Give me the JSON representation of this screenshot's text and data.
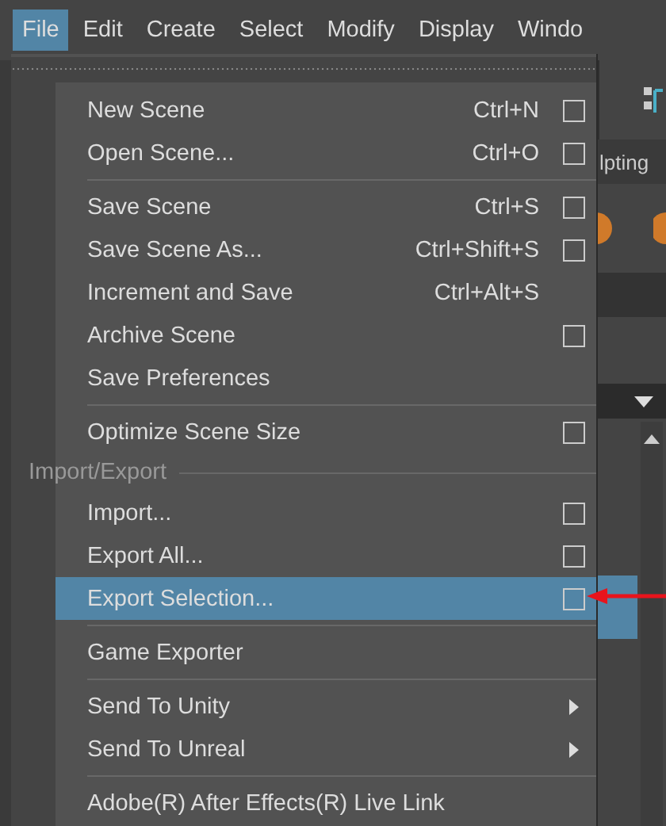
{
  "menubar": [
    {
      "label": "File",
      "selected": true
    },
    {
      "label": "Edit",
      "selected": false
    },
    {
      "label": "Create",
      "selected": false
    },
    {
      "label": "Select",
      "selected": false
    },
    {
      "label": "Modify",
      "selected": false
    },
    {
      "label": "Display",
      "selected": false
    },
    {
      "label": "Windo",
      "selected": false
    }
  ],
  "shelf_tab": "lpting",
  "file_menu": [
    {
      "kind": "item",
      "label": "New Scene",
      "shortcut": "Ctrl+N",
      "option_box": true,
      "submenu": false,
      "selected": false
    },
    {
      "kind": "item",
      "label": "Open Scene...",
      "shortcut": "Ctrl+O",
      "option_box": true,
      "submenu": false,
      "selected": false
    },
    {
      "kind": "separator"
    },
    {
      "kind": "item",
      "label": "Save Scene",
      "shortcut": "Ctrl+S",
      "option_box": true,
      "submenu": false,
      "selected": false
    },
    {
      "kind": "item",
      "label": "Save Scene As...",
      "shortcut": "Ctrl+Shift+S",
      "option_box": true,
      "submenu": false,
      "selected": false
    },
    {
      "kind": "item",
      "label": "Increment and Save",
      "shortcut": "Ctrl+Alt+S",
      "option_box": false,
      "submenu": false,
      "selected": false
    },
    {
      "kind": "item",
      "label": "Archive Scene",
      "option_box": true,
      "submenu": false,
      "selected": false
    },
    {
      "kind": "item",
      "label": "Save Preferences",
      "option_box": false,
      "submenu": false,
      "selected": false
    },
    {
      "kind": "separator"
    },
    {
      "kind": "item",
      "label": "Optimize Scene Size",
      "option_box": true,
      "submenu": false,
      "selected": false
    },
    {
      "kind": "header",
      "label": "Import/Export"
    },
    {
      "kind": "item",
      "label": "Import...",
      "option_box": true,
      "submenu": false,
      "selected": false
    },
    {
      "kind": "item",
      "label": "Export All...",
      "option_box": true,
      "submenu": false,
      "selected": false
    },
    {
      "kind": "item",
      "label": "Export Selection...",
      "option_box": true,
      "submenu": false,
      "selected": true
    },
    {
      "kind": "separator"
    },
    {
      "kind": "item",
      "label": "Game Exporter",
      "option_box": false,
      "submenu": false,
      "selected": false
    },
    {
      "kind": "separator"
    },
    {
      "kind": "item",
      "label": "Send To Unity",
      "option_box": false,
      "submenu": true,
      "selected": false
    },
    {
      "kind": "item",
      "label": "Send To Unreal",
      "option_box": false,
      "submenu": true,
      "selected": false
    },
    {
      "kind": "separator"
    },
    {
      "kind": "item",
      "label": "Adobe(R) After Effects(R) Live Link",
      "option_box": false,
      "submenu": false,
      "selected": false
    }
  ]
}
